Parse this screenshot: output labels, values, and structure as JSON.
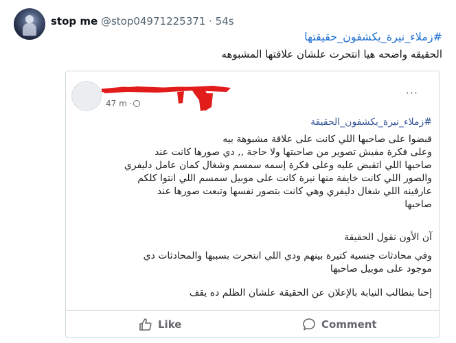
{
  "tweet": {
    "display_name": "stop me",
    "handle": "@stop04971225371",
    "separator": "·",
    "time": "54s",
    "hashtag": "#زملاء_نيرة_يكشفون_حقيقتها",
    "text": "الحقيقه واضحه هيا انتحرت علشان علاقتها المشبوهه"
  },
  "embedded_post": {
    "time": "47 m ·",
    "more": "···",
    "hashtag": "#زملاء_نيرة_يكشفون_الحقيقة",
    "paragraph_1": [
      "قبضوا على صاحبها اللي كانت على علاقة مشبوهة بيه",
      "وعلى فكرة مفيش تصوير من صاحبتها ولا حاجة ,, دي صورها كانت عند",
      "صاحبها اللي اتقبض عليه وعلى فكرة إسمه سمسم وشغال كمان عامل دليفري",
      "والصور اللي كانت خايفة منها نيرة كانت على موبيل سمسم اللي انتوا كلكم",
      "عارفينه اللي شغال دليفري وهي كانت بتصور نفسها وتبعت صورها عند",
      "صاحبها"
    ],
    "paragraph_2": "آن الأون نقول الحقيقة",
    "paragraph_3": [
      "وفي محادثات جنسية كتيرة بينهم ودي اللي انتحرت بسببها والمحادثات دي",
      "موجود على موبيل صاحبها"
    ],
    "paragraph_4": "إحنا بنطالب النيابة بالإعلان عن الحقيقة علشان الظلم ده يقف",
    "actions": {
      "like": "Like",
      "comment": "Comment"
    }
  },
  "colors": {
    "hashtag_blue": "#1d6fd1",
    "redaction_red": "#e21b1b",
    "muted_gray": "#65676b"
  }
}
